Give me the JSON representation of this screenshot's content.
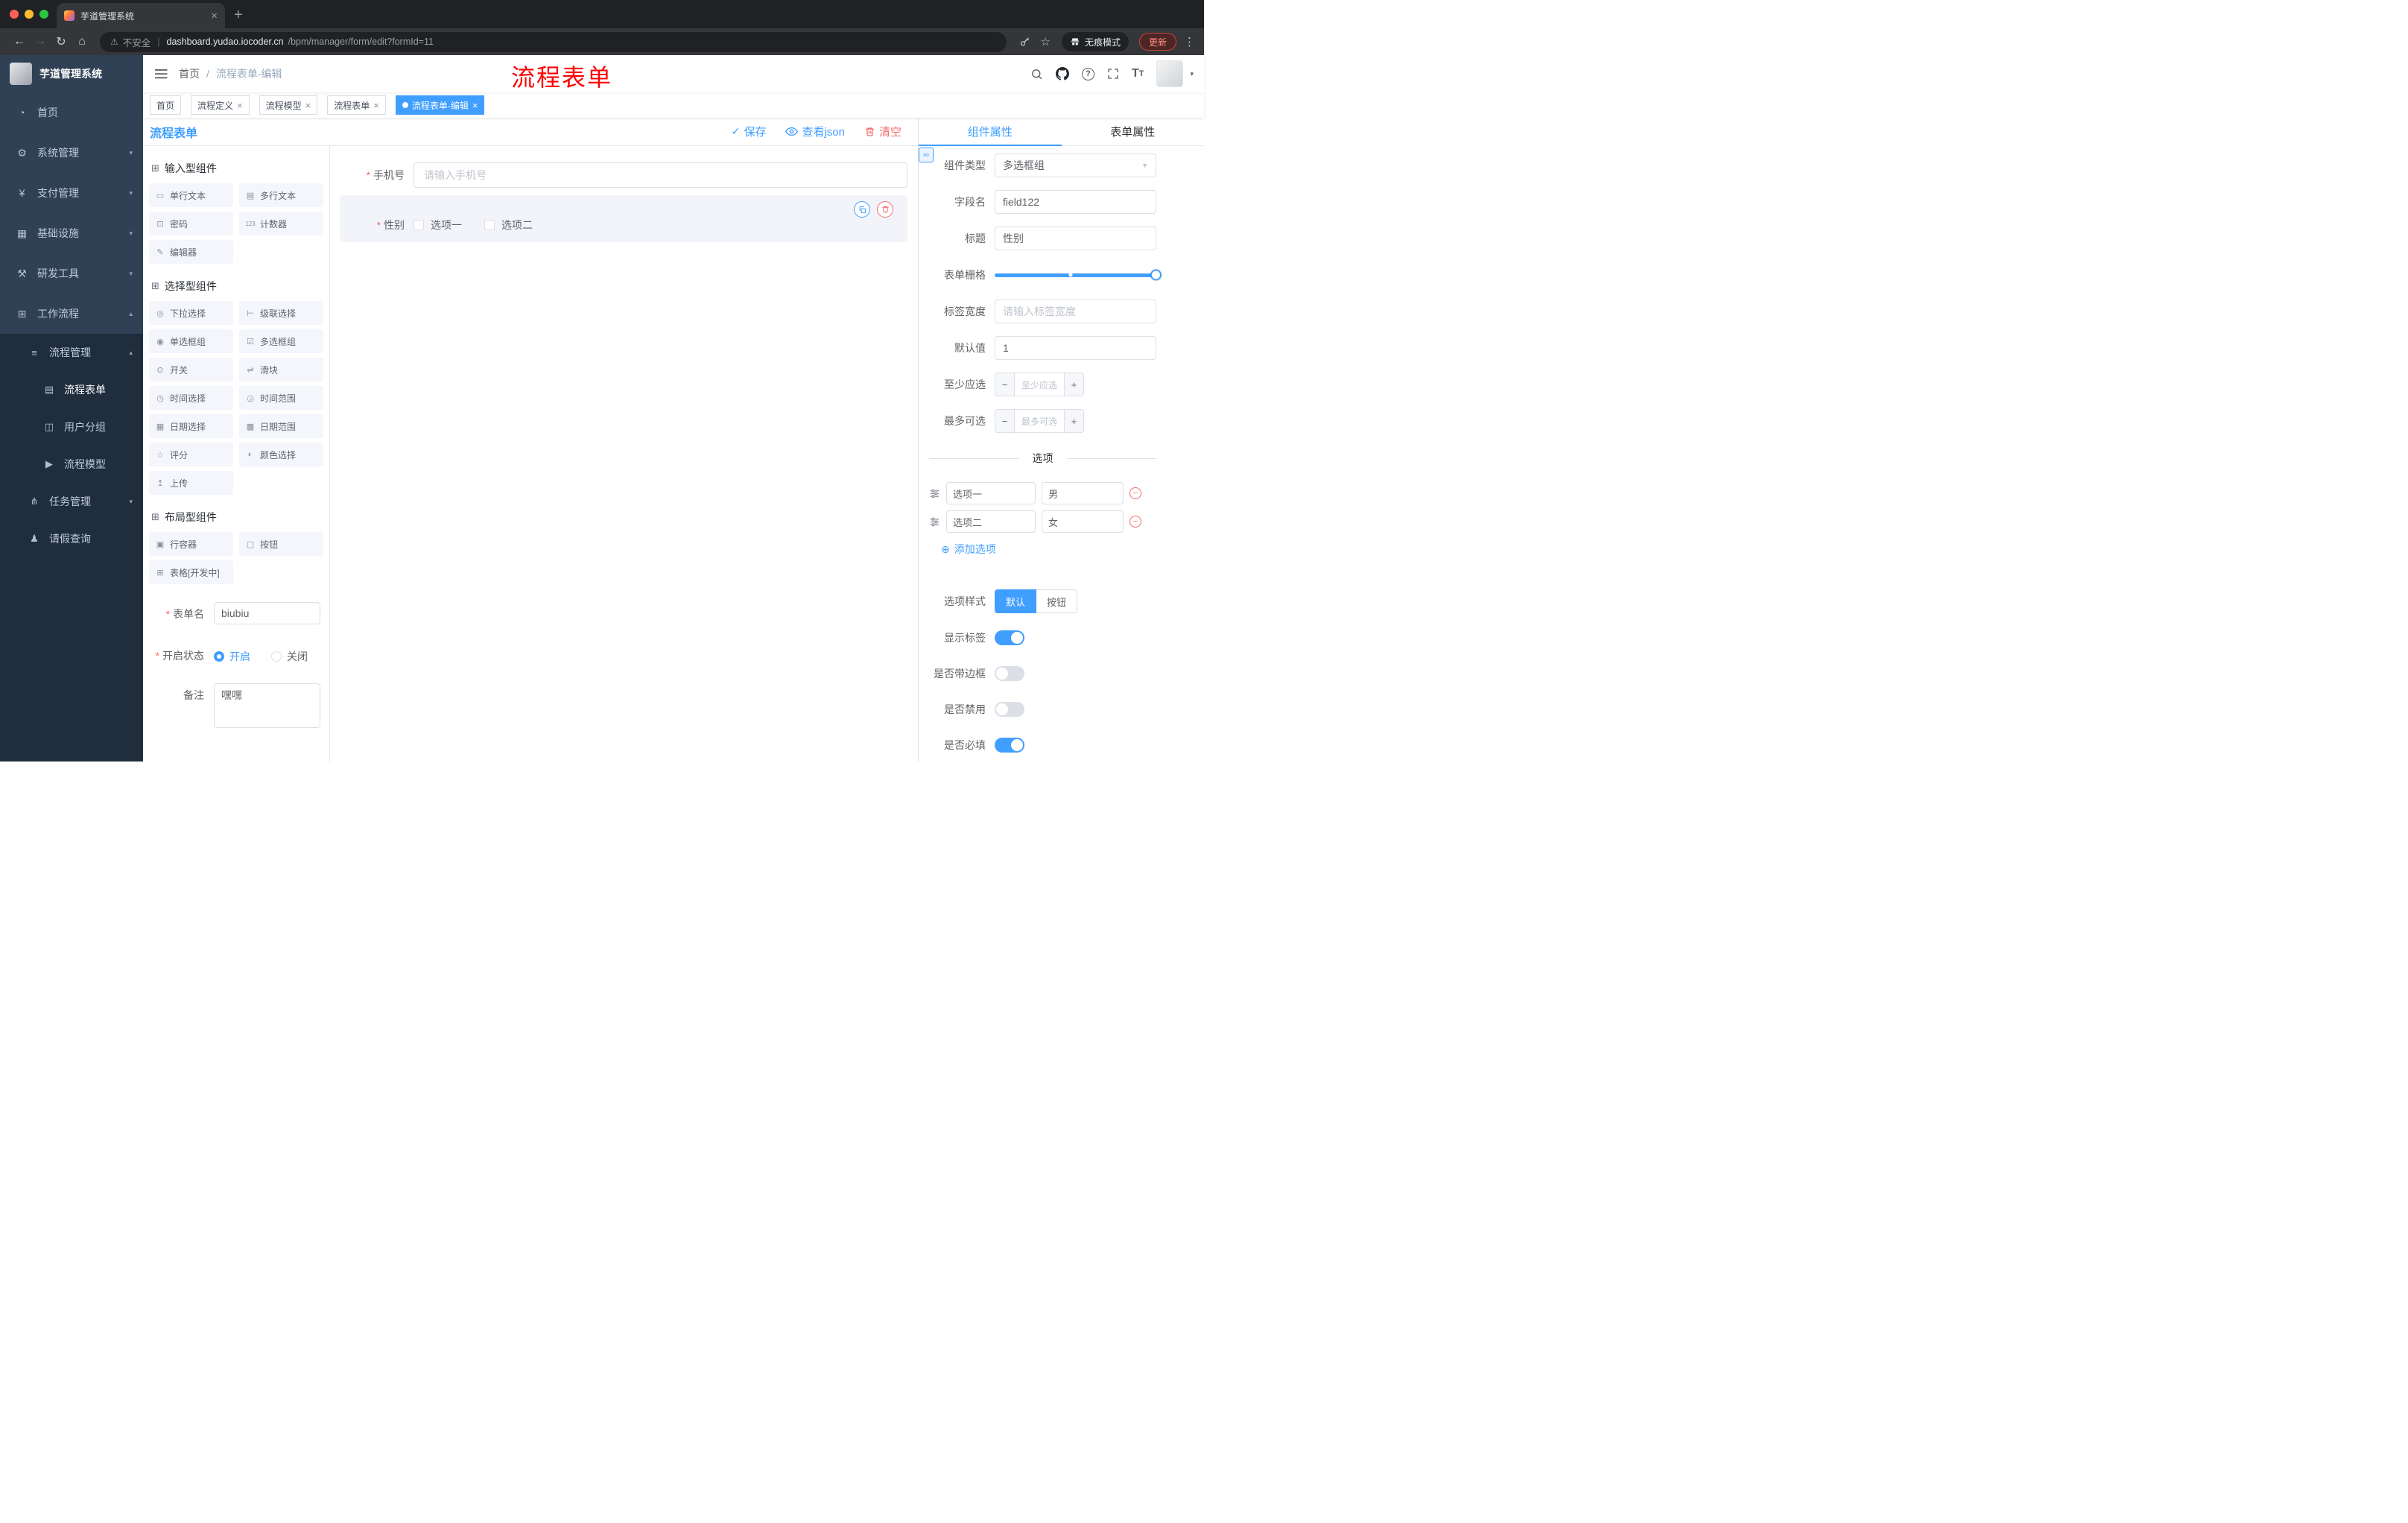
{
  "colors": {
    "primary": "#409eff",
    "danger": "#f56c6c",
    "sidebar_bg": "#304156",
    "submenu_bg": "#1f2d3d",
    "tag_active": "#409eff"
  },
  "browser": {
    "tab_title": "芋道管理系统",
    "security_label": "不安全",
    "url_host": "dashboard.yudao.iocoder.cn",
    "url_path": "/bpm/manager/form/edit?formId=11",
    "incognito_label": "无痕模式",
    "update_label": "更新"
  },
  "sidebar": {
    "logo_title": "芋道管理系统",
    "items": [
      {
        "icon": "◔",
        "label": "首页",
        "arrow": ""
      },
      {
        "icon": "⚙",
        "label": "系统管理",
        "arrow": "▾"
      },
      {
        "icon": "¥",
        "label": "支付管理",
        "arrow": "▾"
      },
      {
        "icon": "▦",
        "label": "基础设施",
        "arrow": "▾"
      },
      {
        "icon": "⚒",
        "label": "研发工具",
        "arrow": "▾"
      },
      {
        "icon": "⊞",
        "label": "工作流程",
        "arrow": "▴"
      }
    ],
    "process_group": {
      "icon": "≡",
      "label": "流程管理",
      "arrow": "▴"
    },
    "process_children": [
      {
        "icon": "▤",
        "label": "流程表单"
      },
      {
        "icon": "◫",
        "label": "用户分组"
      },
      {
        "icon": "▶",
        "label": "流程模型"
      }
    ],
    "task_group": {
      "icon": "⋔",
      "label": "任务管理",
      "arrow": "▾"
    },
    "leave_item": {
      "icon": "♟",
      "label": "请假查询"
    }
  },
  "navbar": {
    "breadcrumb_home": "首页",
    "breadcrumb_sep": "/",
    "breadcrumb_current": "流程表单-编辑",
    "annotation": "流程表单"
  },
  "tags": {
    "items": [
      {
        "label": "首页"
      },
      {
        "label": "流程定义"
      },
      {
        "label": "流程模型"
      },
      {
        "label": "流程表单"
      },
      {
        "label": "流程表单-编辑"
      }
    ]
  },
  "designer": {
    "panel_title": "流程表单",
    "save_label": "保存",
    "view_json_label": "查看json",
    "clear_label": "清空",
    "palette": {
      "sections": [
        {
          "title": "输入型组件",
          "items": [
            {
              "icon": "▭",
              "label": "单行文本"
            },
            {
              "icon": "▤",
              "label": "多行文本"
            },
            {
              "icon": "⊡",
              "label": "密码"
            },
            {
              "icon": "123",
              "label": "计数器"
            },
            {
              "icon": "✎",
              "label": "编辑器"
            }
          ]
        },
        {
          "title": "选择型组件",
          "items": [
            {
              "icon": "◎",
              "label": "下拉选择"
            },
            {
              "icon": "⊢",
              "label": "级联选择"
            },
            {
              "icon": "◉",
              "label": "单选框组"
            },
            {
              "icon": "☑",
              "label": "多选框组"
            },
            {
              "icon": "⊙",
              "label": "开关"
            },
            {
              "icon": "⇌",
              "label": "滑块"
            },
            {
              "icon": "◷",
              "label": "时间选择"
            },
            {
              "icon": "◶",
              "label": "时间范围"
            },
            {
              "icon": "▦",
              "label": "日期选择"
            },
            {
              "icon": "▩",
              "label": "日期范围"
            },
            {
              "icon": "☆",
              "label": "评分"
            },
            {
              "icon": "◐",
              "label": "颜色选择"
            },
            {
              "icon": "↥",
              "label": "上传"
            }
          ]
        },
        {
          "title": "布局型组件",
          "items": [
            {
              "icon": "▣",
              "label": "行容器"
            },
            {
              "icon": "▢",
              "label": "按钮"
            },
            {
              "icon": "⊞",
              "label": "表格[开发中]"
            }
          ]
        }
      ]
    },
    "meta": {
      "name_label": "表单名",
      "name_value": "biubiu",
      "status_label": "开启状态",
      "status_on": "开启",
      "status_off": "关闭",
      "status_checked": "开启",
      "remark_label": "备注",
      "remark_value": "嘿嘿"
    },
    "canvas": {
      "phone_label": "手机号",
      "phone_placeholder": "请输入手机号",
      "gender_label": "性别",
      "gender_option1": "选项一",
      "gender_option2": "选项二"
    }
  },
  "props": {
    "tab_component": "组件属性",
    "tab_form": "表单属性",
    "type_label": "组件类型",
    "type_value": "多选框组",
    "field_label": "字段名",
    "field_value": "field122",
    "title_label": "标题",
    "title_value": "性别",
    "grid_label": "表单栅格",
    "width_label": "标签宽度",
    "width_placeholder": "请输入标签宽度",
    "default_label": "默认值",
    "default_value": "1",
    "min_label": "至少应选",
    "min_placeholder": "至少应选",
    "max_label": "最多可选",
    "max_placeholder": "最多可选",
    "options_divider": "选项",
    "option_rows": [
      {
        "name": "选项一",
        "value": "男"
      },
      {
        "name": "选项二",
        "value": "女"
      }
    ],
    "add_option": "添加选项",
    "style_label": "选项样式",
    "style_default": "默认",
    "style_button": "按钮",
    "switches": [
      {
        "label": "显示标签",
        "on": true
      },
      {
        "label": "是否带边框",
        "on": false
      },
      {
        "label": "是否禁用",
        "on": false
      },
      {
        "label": "是否必填",
        "on": true
      }
    ]
  }
}
